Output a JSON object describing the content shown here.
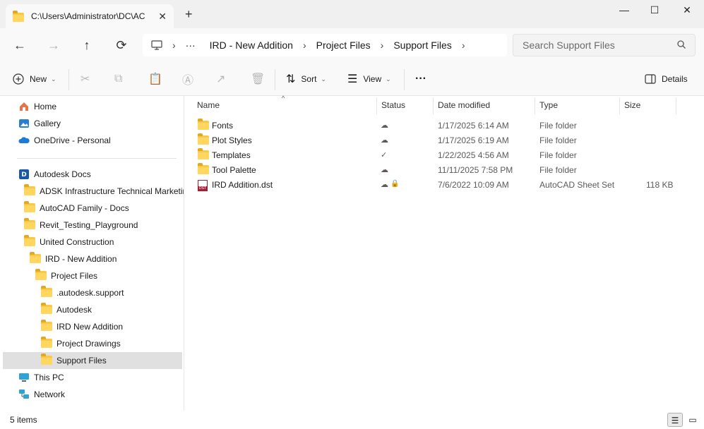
{
  "window": {
    "tab_title": "C:\\Users\\Administrator\\DC\\AC",
    "tab_close": "✕",
    "new_tab": "+",
    "minimize": "—",
    "maximize": "☐",
    "close": "✕"
  },
  "nav": {
    "back": "←",
    "forward": "→",
    "up": "↑",
    "refresh": "⟳",
    "breadcrumb": [
      "IRD - New Addition",
      "Project Files",
      "Support Files"
    ],
    "ellipsis": "···",
    "search_placeholder": "Search Support Files"
  },
  "toolbar": {
    "new_label": "New",
    "sort_label": "Sort",
    "view_label": "View",
    "more": "···",
    "details_label": "Details"
  },
  "sidebar": {
    "items": [
      {
        "label": "Home",
        "icon": "home-icon"
      },
      {
        "label": "Gallery",
        "icon": "gallery-icon"
      },
      {
        "label": "OneDrive - Personal",
        "icon": "onedrive-icon"
      },
      {
        "label": "Autodesk Docs",
        "icon": "autodesk-docs-icon"
      },
      {
        "label": "ADSK Infrastructure Technical Marketing",
        "icon": "folder-icon"
      },
      {
        "label": "AutoCAD Family - Docs",
        "icon": "folder-icon"
      },
      {
        "label": "Revit_Testing_Playground",
        "icon": "folder-icon"
      },
      {
        "label": "United Construction",
        "icon": "folder-icon"
      },
      {
        "label": "IRD - New Addition",
        "icon": "folder-icon"
      },
      {
        "label": "Project Files",
        "icon": "folder-icon"
      },
      {
        "label": ".autodesk.support",
        "icon": "folder-icon"
      },
      {
        "label": "Autodesk",
        "icon": "folder-icon"
      },
      {
        "label": "IRD New Addition",
        "icon": "folder-icon"
      },
      {
        "label": "Project Drawings",
        "icon": "folder-icon"
      },
      {
        "label": "Support Files",
        "icon": "folder-icon"
      },
      {
        "label": "This PC",
        "icon": "this-pc-icon"
      },
      {
        "label": "Network",
        "icon": "network-icon"
      }
    ]
  },
  "columns": {
    "name": "Name",
    "status": "Status",
    "date": "Date modified",
    "type": "Type",
    "size": "Size"
  },
  "files": [
    {
      "name": "Fonts",
      "status": "cloud",
      "date": "1/17/2025 6:14 AM",
      "type": "File folder",
      "size": ""
    },
    {
      "name": "Plot Styles",
      "status": "cloud",
      "date": "1/17/2025 6:19 AM",
      "type": "File folder",
      "size": ""
    },
    {
      "name": "Templates",
      "status": "synced",
      "date": "1/22/2025 4:56 AM",
      "type": "File folder",
      "size": ""
    },
    {
      "name": "Tool Palette",
      "status": "cloud",
      "date": "11/11/2025 7:58 PM",
      "type": "File folder",
      "size": ""
    },
    {
      "name": "IRD Addition.dst",
      "status": "cloud-locked",
      "date": "7/6/2022 10:09 AM",
      "type": "AutoCAD Sheet Set",
      "size": "118 KB"
    }
  ],
  "status_bar": {
    "item_count": "5 items"
  },
  "colors": {
    "accent": "#2b7cd3",
    "folder": "#f8c946",
    "synced": "#1e8b3a",
    "selection": "#e0e0e0"
  }
}
